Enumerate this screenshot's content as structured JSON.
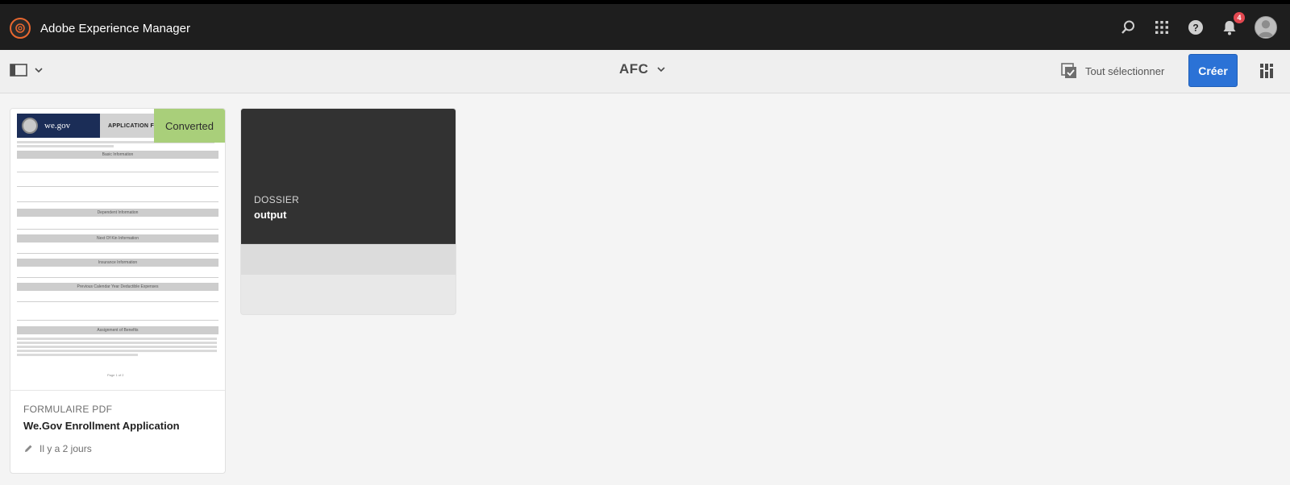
{
  "header": {
    "app_title": "Adobe Experience Manager",
    "notification_count": "4",
    "icons": [
      "search-icon",
      "apps-grid-icon",
      "help-icon",
      "bell-icon",
      "user-avatar"
    ]
  },
  "actionbar": {
    "folder_title": "AFC",
    "select_all_label": "Tout sélectionner",
    "create_label": "Créer"
  },
  "cards": [
    {
      "type": "FORMULAIRE PDF",
      "name": "We.Gov Enrollment Application",
      "modified": "Il y a 2 jours",
      "status": "Converted",
      "preview": {
        "logo_text": "we.gov",
        "title_text": "APPLICATION FOR",
        "sections": [
          "Basic Information",
          "Dependent Information",
          "Next Of Kin Information",
          "Insurance Information",
          "Previous Calendar Year Deductible Expenses",
          "Assignment of Benefits"
        ],
        "page_label": "Page 1 of 2"
      }
    },
    {
      "type": "DOSSIER",
      "name": "output"
    }
  ],
  "colors": {
    "topbar": "#1e1e1e",
    "accent_blue": "#2b72d6",
    "converted_green": "#a9cf7a",
    "brand_orange": "#e8672f"
  }
}
